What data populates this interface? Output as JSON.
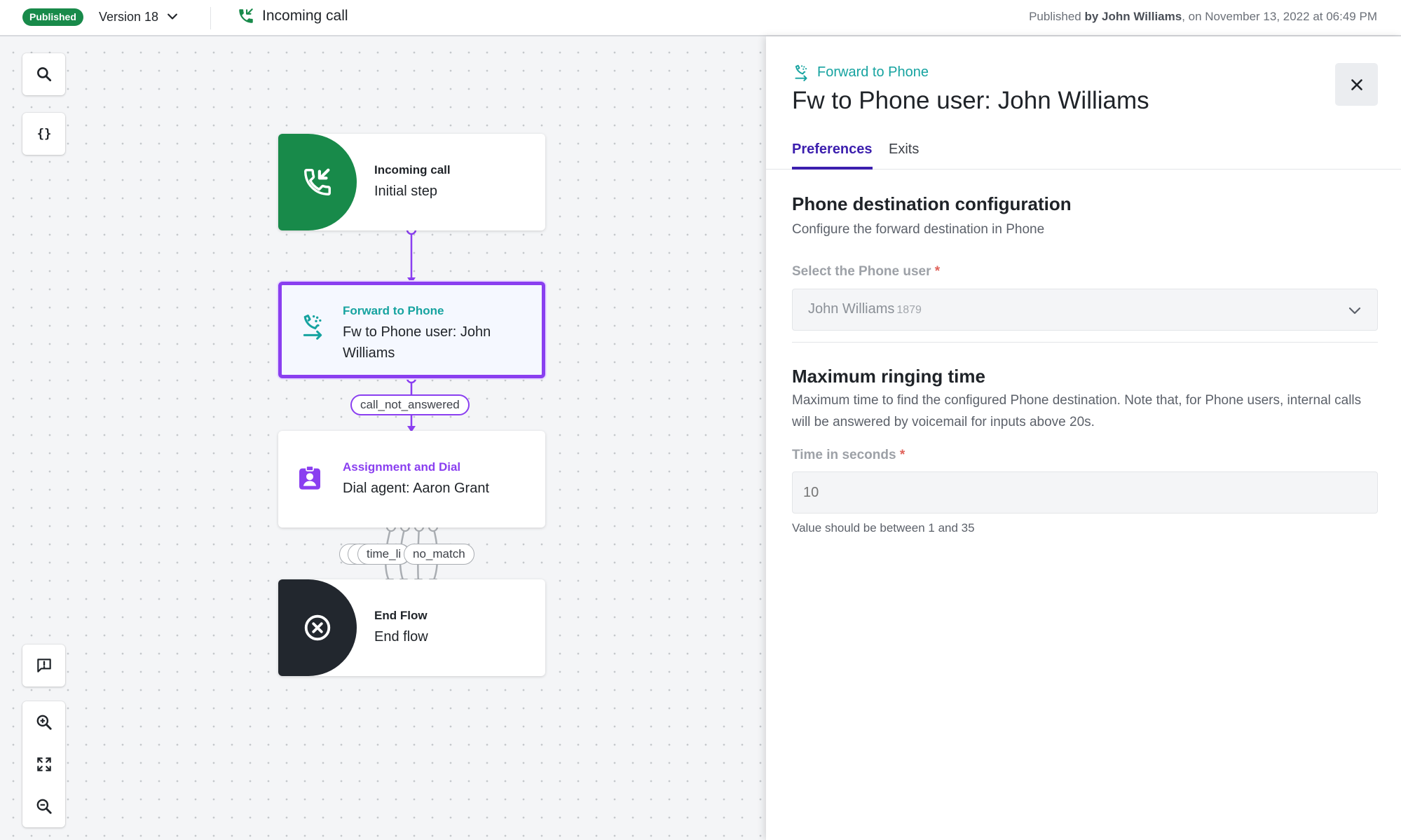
{
  "topbar": {
    "status_badge": "Published",
    "version_label": "Version 18",
    "flow_name": "Incoming call",
    "published_prefix": "Published ",
    "published_by": "by John Williams",
    "published_suffix": ", on November 13, 2022 at 06:49 PM"
  },
  "canvas": {
    "tools": [
      "search-icon",
      "braces-icon",
      "feedback-icon",
      "zoom-in-icon",
      "fit-screen-icon",
      "zoom-out-icon"
    ],
    "nodes": [
      {
        "type": "Incoming call",
        "label": "Initial step",
        "color": "#188a4a"
      },
      {
        "type": "Forward to Phone",
        "label": "Fw to Phone user: John Williams",
        "color": "#16a3a0",
        "selected": true
      },
      {
        "type": "Assignment and Dial",
        "label": "Dial agent: Aaron Grant",
        "color": "#8a3ff0"
      },
      {
        "type": "End Flow",
        "label": "End flow",
        "color": "#22272e"
      }
    ],
    "edge_labels": {
      "forward_exit": "call_not_answered",
      "dial_exit_a": "time_li",
      "dial_exit_b": "no_match"
    },
    "accent_color": "#8a3ff0"
  },
  "panel": {
    "node_type": "Forward to Phone",
    "title": "Fw to Phone user: John Williams",
    "tabs": [
      {
        "label": "Preferences",
        "active": true
      },
      {
        "label": "Exits",
        "active": false
      }
    ],
    "section1": {
      "title": "Phone destination configuration",
      "subtitle": "Configure the forward destination in Phone",
      "field_label": "Select the Phone user",
      "required_mark": "*",
      "selected_value": "John Williams",
      "selected_ext": "1879"
    },
    "section2": {
      "title": "Maximum ringing time",
      "subtitle": "Maximum time to find the configured Phone destination. Note that, for Phone users, internal calls will be answered by voicemail for inputs above 20s.",
      "field_label": "Time in seconds",
      "required_mark": "*",
      "value": "10",
      "hint": "Value should be between 1 and 35"
    }
  }
}
